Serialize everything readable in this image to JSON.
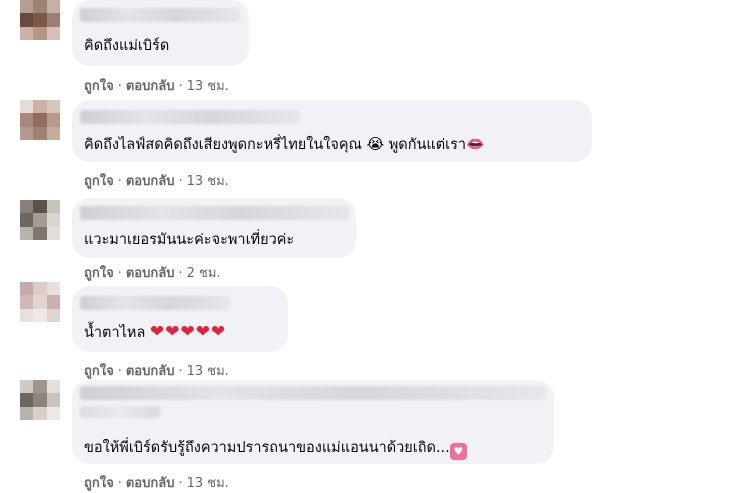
{
  "comments": [
    {
      "text": "คิดถึงแม่เบิร์ด",
      "like": "ถูกใจ",
      "reply": "ตอบกลับ",
      "time": "13 ชม.",
      "avatar_colors": [
        "#a58a7a",
        "#8e6e5e",
        "#b49a8b",
        "#6a4a3a",
        "#7d5a48",
        "#9c7f70",
        "#c9b4a8",
        "#b29686",
        "#d4c2b8"
      ]
    },
    {
      "text": "คิดถึงไลฟ์สดคิดถึงเสียงพูดกะหรี่ไทยในใจคุณ",
      "emoji": "😭",
      "text_after": "พูดกันแต่เรา",
      "emoji_after": "👄",
      "like": "ถูกใจ",
      "reply": "ตอบกลับ",
      "time": "13 ชม.",
      "avatar_colors": [
        "#e6dcd6",
        "#c9b1a3",
        "#d8c6bb",
        "#a9887a",
        "#8f6c5c",
        "#b79a8c",
        "#b39a8e",
        "#9e8273",
        "#c4ad9f"
      ]
    },
    {
      "text": "แวะมาเยอรมันนะค่ะจะพาเที่ยวค่ะ",
      "like": "ถูกใจ",
      "reply": "ตอบกลับ",
      "time": "2 ชม.",
      "avatar_colors": [
        "#8a8278",
        "#5a534c",
        "#c8c2bc",
        "#6e6760",
        "#a39d96",
        "#d9d4cf",
        "#b8b2ab",
        "#7d766f",
        "#e2ddd8"
      ]
    },
    {
      "text": "น้ำตาไหล",
      "hearts": "❤❤❤❤❤",
      "like": "ถูกใจ",
      "reply": "ตอบกลับ",
      "time": "13 ชม.",
      "avatar_colors": [
        "#c7a9ad",
        "#dccbc8",
        "#e9e0dc",
        "#d2b7b6",
        "#e3d3d1",
        "#c9b2b0",
        "#e6e1df",
        "#efeae8",
        "#ddd5d3"
      ]
    },
    {
      "text": "ขอให้พี่เบิร์ดรับรู้ถึงความปรารถนาของแม่แอนนาด้วยเถิด...",
      "emoji": "💟",
      "like": "ถูกใจ",
      "reply": "ตอบกลับ",
      "time": "13 ชม.",
      "avatar_colors": [
        "#cfcac4",
        "#9e968c",
        "#e4e0dc",
        "#6e675f",
        "#8c857c",
        "#c8c3bd",
        "#b9b3ac",
        "#d6d1cc",
        "#ece9e6"
      ]
    }
  ],
  "separator": "·"
}
